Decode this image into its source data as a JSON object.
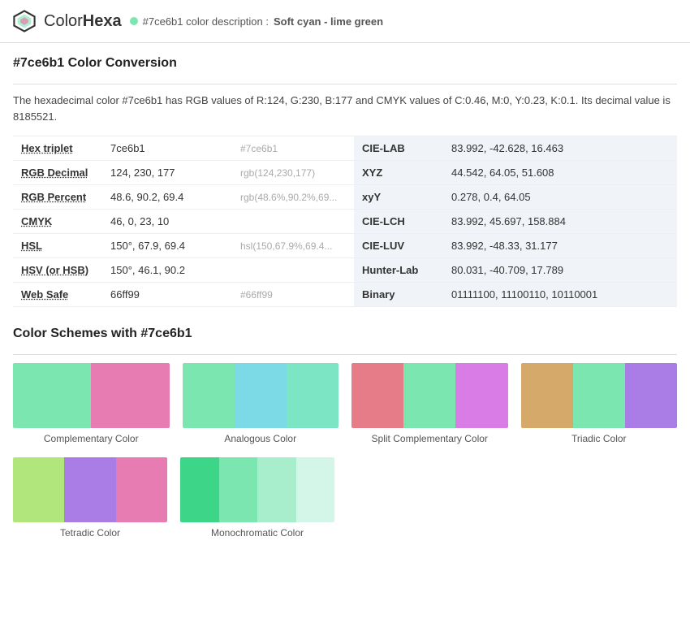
{
  "header": {
    "logo_color": "Color",
    "logo_bold": "Hexa",
    "color_hex": "#7ce6b1",
    "color_dot": "#7ce6b1",
    "description": "#7ce6b1 color description :",
    "color_name": "Soft cyan - lime green",
    "color_name_bold": "."
  },
  "page_title": "#7ce6b1 Color Conversion",
  "description_text": "The hexadecimal color #7ce6b1 has RGB values of R:124, G:230, B:177 and CMYK values of C:0.46, M:0, Y:0.23, K:0.1. Its decimal value is 8185521.",
  "table": {
    "rows": [
      {
        "left_label": "Hex triplet",
        "left_value": "7ce6b1",
        "left_preview": "#7ce6b1",
        "right_label": "CIE-LAB",
        "right_value": "83.992, -42.628, 16.463"
      },
      {
        "left_label": "RGB Decimal",
        "left_value": "124, 230, 177",
        "left_preview": "rgb(124,230,177)",
        "right_label": "XYZ",
        "right_value": "44.542, 64.05, 51.608"
      },
      {
        "left_label": "RGB Percent",
        "left_value": "48.6, 90.2, 69.4",
        "left_preview": "rgb(48.6%,90.2%,69...",
        "right_label": "xyY",
        "right_value": "0.278, 0.4, 64.05"
      },
      {
        "left_label": "CMYK",
        "left_value": "46, 0, 23, 10",
        "left_preview": "",
        "right_label": "CIE-LCH",
        "right_value": "83.992, 45.697, 158.884"
      },
      {
        "left_label": "HSL",
        "left_value": "150°, 67.9, 69.4",
        "left_preview": "hsl(150,67.9%,69.4...",
        "right_label": "CIE-LUV",
        "right_value": "83.992, -48.33, 31.177"
      },
      {
        "left_label": "HSV (or HSB)",
        "left_value": "150°, 46.1, 90.2",
        "left_preview": "",
        "right_label": "Hunter-Lab",
        "right_value": "80.031, -40.709, 17.789"
      },
      {
        "left_label": "Web Safe",
        "left_value": "66ff99",
        "left_preview": "#66ff99",
        "right_label": "Binary",
        "right_value": "01111100, 11100110, 10110001"
      }
    ]
  },
  "schemes_title": "Color Schemes with #7ce6b1",
  "schemes": [
    {
      "label": "Complementary Color",
      "swatches": [
        "#7ce6b1",
        "#e67cb1"
      ]
    },
    {
      "label": "Analogous Color",
      "swatches": [
        "#7ce6b1",
        "#7cd9e6",
        "#7ce6c4"
      ]
    },
    {
      "label": "Split Complementary Color",
      "swatches": [
        "#e67c88",
        "#7ce6b1",
        "#d97ce6"
      ]
    },
    {
      "label": "Triadic Color",
      "swatches": [
        "#d4a96a",
        "#7ce6b1",
        "#a97ce6"
      ]
    }
  ],
  "schemes2": [
    {
      "label": "Tetradic Color",
      "swatches": [
        "#b1e67c",
        "#a97ce6",
        "#e67cb1"
      ]
    },
    {
      "label": "Monochromatic Color",
      "swatches": [
        "#3dd688",
        "#7ce6b1",
        "#a8edcc",
        "#d4f6e8"
      ]
    }
  ]
}
